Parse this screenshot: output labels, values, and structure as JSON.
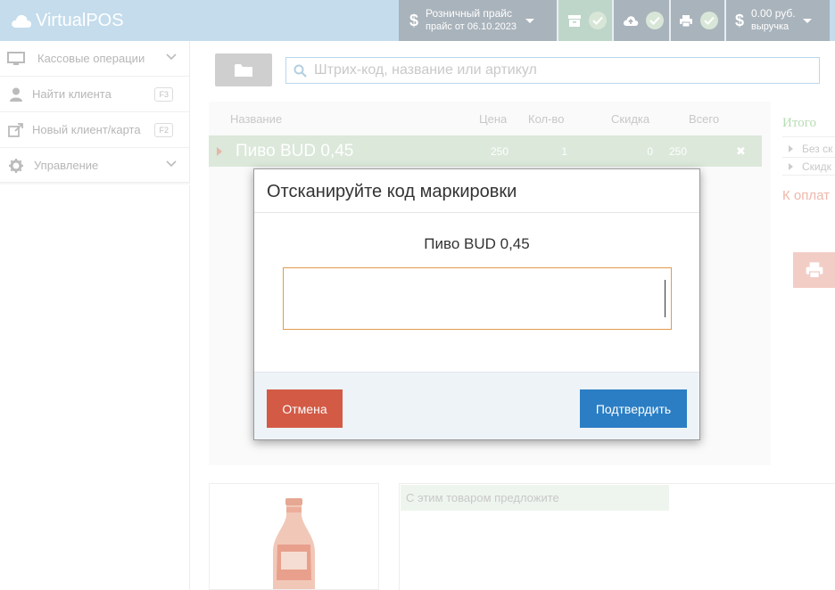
{
  "app": {
    "title": "VirtualPOS"
  },
  "header": {
    "price": {
      "line1": "Розничный прайс",
      "line2": "прайс от 06.10.2023"
    },
    "revenue": {
      "line1": "0.00 руб.",
      "line2": "выручка"
    },
    "icons": [
      "archive-icon",
      "cloud-upload-icon",
      "print-icon"
    ],
    "colors": {
      "bar": "#c4dcec",
      "gray_block": "#a9b3bb",
      "green_block": "#bed6c9"
    }
  },
  "sidebar": {
    "items": [
      {
        "label": "Кассовые операции",
        "icon": "monitor-icon",
        "suffix": "chevron"
      },
      {
        "label": "Найти клиента",
        "icon": "user-icon",
        "shortcut": "F3"
      },
      {
        "label": "Новый клиент/карта",
        "icon": "external-link-icon",
        "shortcut": "F2"
      },
      {
        "label": "Управление",
        "icon": "gear-icon",
        "suffix": "chevron"
      }
    ]
  },
  "search": {
    "placeholder": "Штрих-код, название или артикул"
  },
  "table": {
    "columns": [
      "Название",
      "Цена",
      "Кол-во",
      "Скидка",
      "Всего"
    ],
    "rows": [
      {
        "name": "Пиво BUD 0,45",
        "price": "250",
        "qty": "1",
        "discount": "0",
        "total": "250"
      }
    ]
  },
  "totals": {
    "title": "Итого",
    "items": [
      "Без ск",
      "Скидк"
    ],
    "to_pay": "К оплат"
  },
  "suggest": {
    "title": "С этим товаром предложите"
  },
  "modal": {
    "title": "Отсканируйте код маркировки",
    "product": "Пиво BUD 0,45",
    "input_value": "",
    "cancel_label": "Отмена",
    "confirm_label": "Подтвердить",
    "colors": {
      "cancel": "#d35a45",
      "confirm": "#2b7ec4",
      "input_border": "#e29a4a"
    }
  }
}
